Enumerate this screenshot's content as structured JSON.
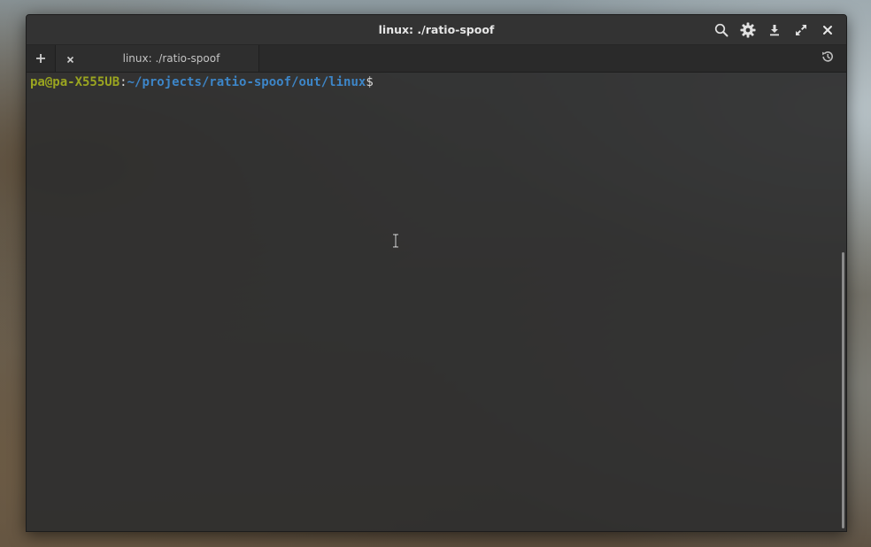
{
  "window": {
    "title": "linux: ./ratio-spoof"
  },
  "title_controls": [
    {
      "name": "search-button",
      "icon": "search-icon"
    },
    {
      "name": "settings-button",
      "icon": "gear-icon"
    },
    {
      "name": "download-button",
      "icon": "download-icon"
    },
    {
      "name": "fullscreen-button",
      "icon": "fullscreen-icon"
    },
    {
      "name": "close-button",
      "icon": "close-icon"
    }
  ],
  "tabbar": {
    "new_tab_icon": "plus-icon",
    "history_icon": "history-icon",
    "tabs": [
      {
        "label": "linux: ./ratio-spoof",
        "close_icon": "close-icon"
      }
    ]
  },
  "terminal": {
    "prompt": {
      "user_host": "pa@pa-X555UB",
      "colon": ":",
      "path": "~/projects/ratio-spoof/out/linux",
      "symbol": "$"
    }
  },
  "colors": {
    "prompt_user": "#9aa520",
    "prompt_path": "#3d86c8",
    "terminal_bg": "#2e2e2e",
    "title_text": "#e6e6e6"
  }
}
